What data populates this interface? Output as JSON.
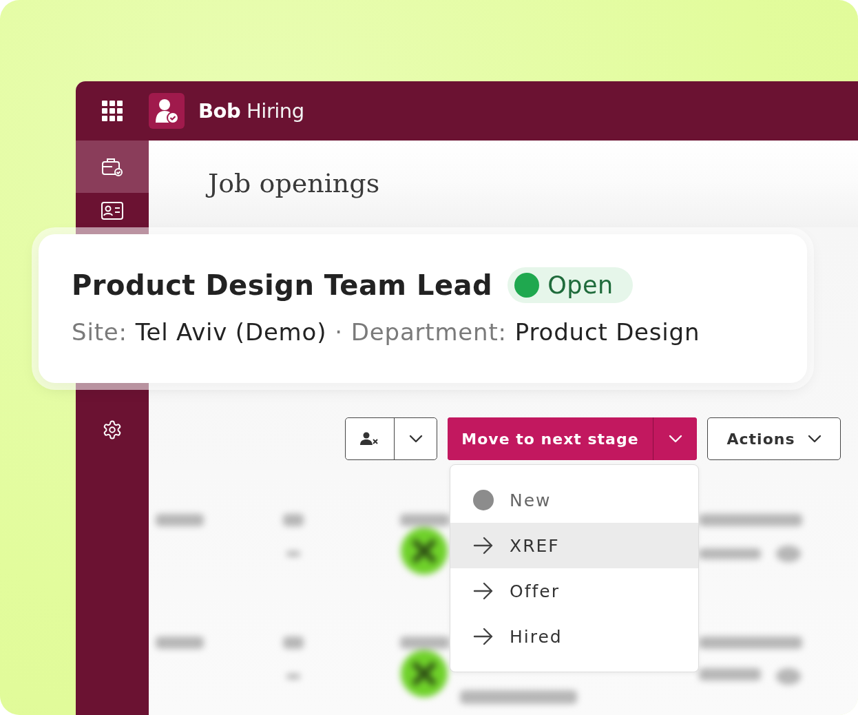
{
  "app": {
    "name": "**Bob** Hiring"
  },
  "sidebar": {
    "items": [
      {
        "kind": "briefcase",
        "selected": true
      },
      {
        "kind": "card",
        "selected": false
      },
      {
        "kind": "settings",
        "selected": false
      }
    ]
  },
  "page": {
    "title": "Job openings"
  },
  "job_card": {
    "title": "Product Design Team Lead",
    "status": {
      "label": "Open",
      "color": "#1fa84f"
    },
    "site_label": "Site:",
    "site": "Tel Aviv (Demo)",
    "separator": "·",
    "department_label": "Department:",
    "department": "Product Design"
  },
  "toolbar": {
    "primary_button": "Move to next stage",
    "actions_button": "Actions"
  },
  "stage_menu": {
    "items": [
      {
        "label": "New",
        "kind": "current",
        "highlighted": false
      },
      {
        "label": "XREF",
        "kind": "next",
        "highlighted": true
      },
      {
        "label": "Offer",
        "kind": "next",
        "highlighted": false
      },
      {
        "label": "Hired",
        "kind": "next",
        "highlighted": false
      }
    ]
  }
}
